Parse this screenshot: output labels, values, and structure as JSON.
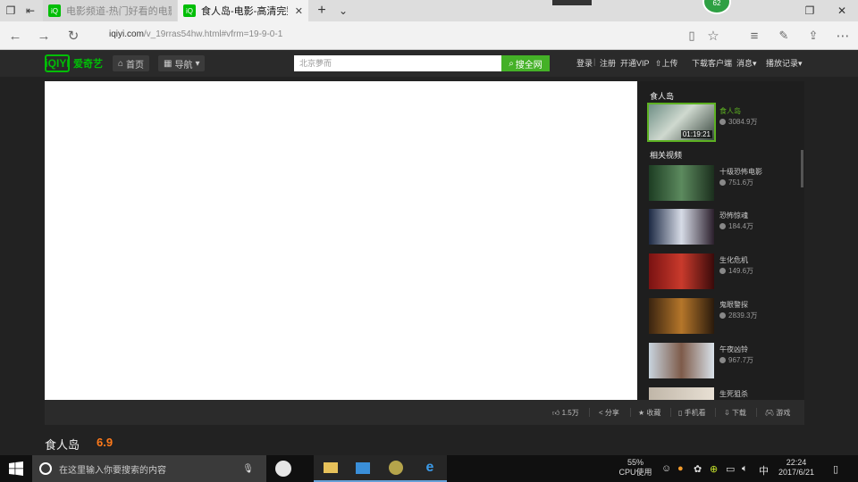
{
  "browser": {
    "tabs": [
      {
        "title": "电影频道-热门好看的电影大",
        "active": false
      },
      {
        "title": "食人岛-电影-高清完整版",
        "active": true
      }
    ],
    "url_host": "iqiyi.com",
    "url_path": "/v_19rras54hw.html#vfrm=19-9-0-1",
    "badge": "62"
  },
  "site": {
    "logo_mark": "iQIYI",
    "logo_name": "爱奇艺",
    "home_label": "首页",
    "nav_label": "导航",
    "search_placeholder": "北京夢而",
    "search_button": "搜全网",
    "links": {
      "login": "登录",
      "register": "注册",
      "vip": "开通VIP",
      "upload": "上传",
      "client": "下载客户端",
      "messages": "消息",
      "history": "播放记录"
    }
  },
  "sidebar": {
    "current_heading": "食人岛",
    "current": {
      "title": "食人岛",
      "plays": "3084.9万",
      "duration": "01:19:21"
    },
    "related_heading": "相关视频",
    "related": [
      {
        "title": "十级恐怖电影",
        "plays": "751.6万"
      },
      {
        "title": "恐怖惊魂",
        "plays": "184.4万"
      },
      {
        "title": "生化危机",
        "plays": "149.6万"
      },
      {
        "title": "鬼眼警探",
        "plays": "2839.3万"
      },
      {
        "title": "午夜凶铃",
        "plays": "967.7万"
      },
      {
        "title": "生死狙杀",
        "plays": ""
      }
    ]
  },
  "toolbar": {
    "likes": "1.5万",
    "share": "分享",
    "collect": "收藏",
    "phone": "手机看",
    "download": "下载",
    "game": "游戏"
  },
  "movie": {
    "title": "食人岛",
    "score": "6.9"
  },
  "taskbar": {
    "search_placeholder": "在这里输入你要搜索的内容",
    "cpu_percent": "55%",
    "cpu_label": "CPU使用",
    "ime": "中",
    "time": "22:24",
    "date": "2017/6/21"
  }
}
